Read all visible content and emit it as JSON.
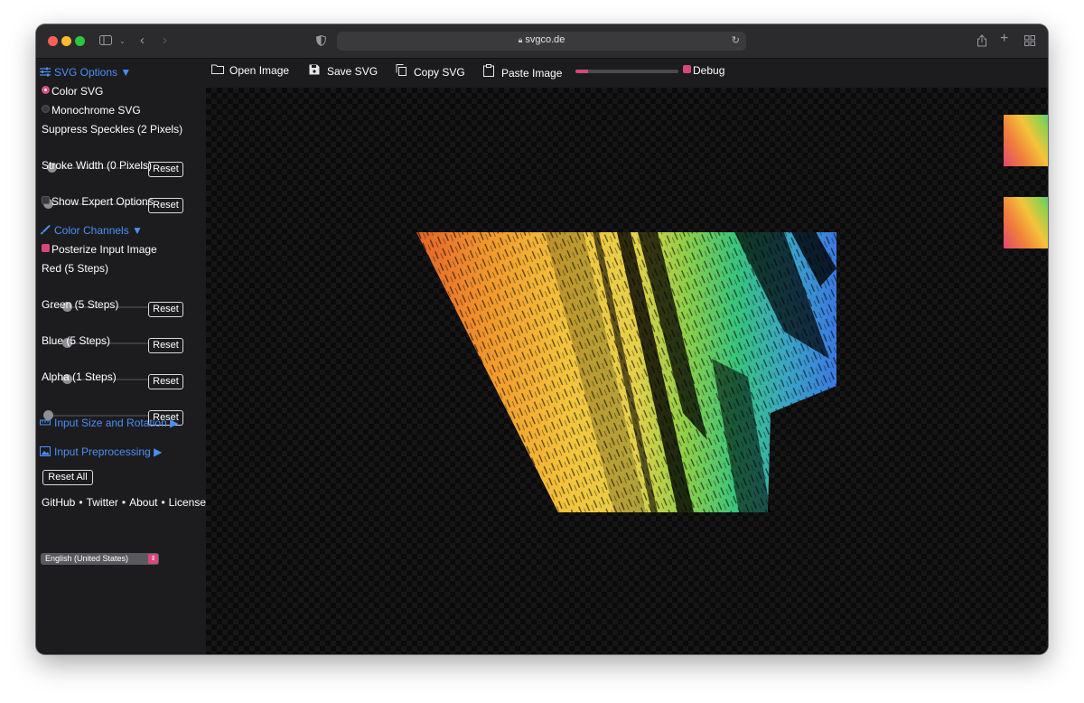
{
  "browser": {
    "url": "svgco.de"
  },
  "toolbar": {
    "open_label": "Open Image",
    "save_label": "Save SVG",
    "copy_label": "Copy SVG",
    "paste_label": "Paste Image",
    "progress_fraction": 0.12,
    "debug_label": "Debug",
    "debug_checked": true
  },
  "sidebar": {
    "svg_options": {
      "heading": "SVG Options ▼",
      "color_svg": "Color SVG",
      "monochrome_svg": "Monochrome SVG",
      "suppress_label": "Suppress Speckles (2 Pixels)",
      "stroke_label": "Stroke Width (0 Pixels)",
      "expert_label": "Show Expert Options",
      "reset_label": "Reset"
    },
    "color_channels": {
      "heading": "Color Channels ▼",
      "posterize_label": "Posterize Input Image",
      "red_label": "Red (5 Steps)",
      "green_label": "Green (5 Steps)",
      "blue_label": "Blue (5 Steps)",
      "alpha_label": "Alpha (1 Steps)"
    },
    "input_size_heading": "Input Size and Rotation ▶",
    "input_preprocessing_heading": "Input Preprocessing ▶",
    "reset_all_label": "Reset All",
    "links": [
      "GitHub",
      "Twitter",
      "About",
      "License"
    ],
    "link_separator": "•",
    "language": "English (United States)"
  },
  "colors": {
    "accent": "#d7467c",
    "link_blue": "#4a8ff7",
    "background": "#1c1c1e"
  }
}
